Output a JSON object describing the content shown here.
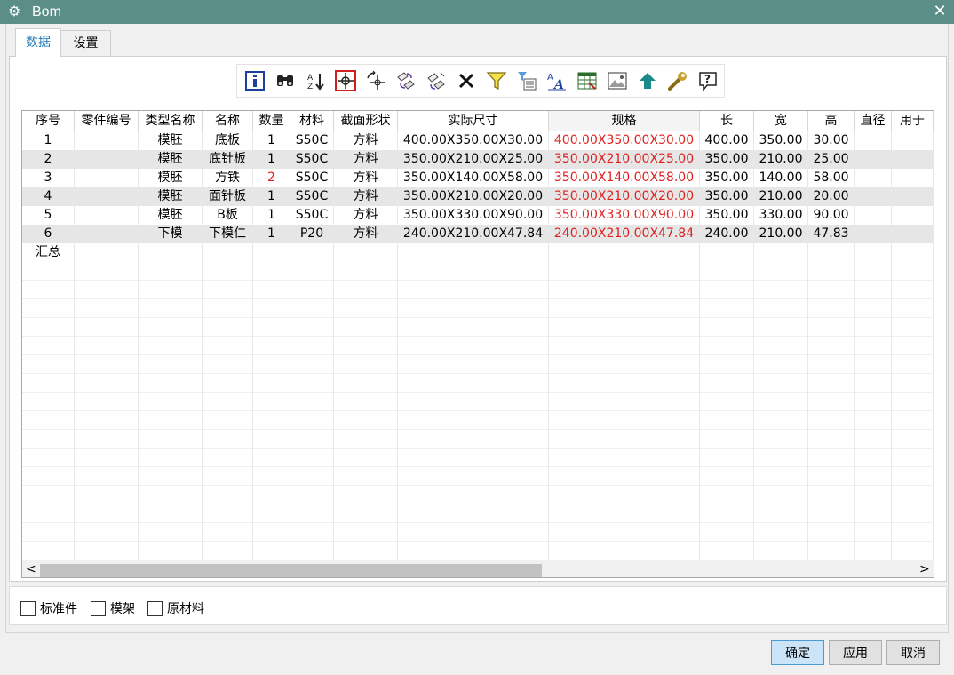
{
  "window": {
    "title": "Bom",
    "icon": "gear-icon",
    "close_icon": "close-icon"
  },
  "tabs": [
    {
      "label": "数据",
      "active": true
    },
    {
      "label": "设置",
      "active": false
    }
  ],
  "toolbar": {
    "icons": [
      "info-icon",
      "binoculars-icon",
      "sort-az-icon",
      "crosshair-icon",
      "rotate-point-icon",
      "swap-part-icon",
      "swap-part-2-icon",
      "delete-icon",
      "filter-icon",
      "column-filter-icon",
      "font-icon",
      "table-export-icon",
      "image-icon",
      "upload-arrow-icon",
      "wrench-icon",
      "help-icon"
    ]
  },
  "table": {
    "headers": [
      "序号",
      "零件编号",
      "类型名称",
      "名称",
      "数量",
      "材料",
      "截面形状",
      "实际尺寸",
      "规格",
      "长",
      "宽",
      "高",
      "直径",
      "用于"
    ],
    "rows": [
      [
        "1",
        "",
        "模胚",
        "底板",
        "1",
        "S50C",
        "方料",
        "400.00X350.00X30.00",
        "400.00X350.00X30.00",
        "400.00",
        "350.00",
        "30.00",
        "",
        ""
      ],
      [
        "2",
        "",
        "模胚",
        "底针板",
        "1",
        "S50C",
        "方料",
        "350.00X210.00X25.00",
        "350.00X210.00X25.00",
        "350.00",
        "210.00",
        "25.00",
        "",
        ""
      ],
      [
        "3",
        "",
        "模胚",
        "方铁",
        "2",
        "S50C",
        "方料",
        "350.00X140.00X58.00",
        "350.00X140.00X58.00",
        "350.00",
        "140.00",
        "58.00",
        "",
        ""
      ],
      [
        "4",
        "",
        "模胚",
        "面针板",
        "1",
        "S50C",
        "方料",
        "350.00X210.00X20.00",
        "350.00X210.00X20.00",
        "350.00",
        "210.00",
        "20.00",
        "",
        ""
      ],
      [
        "5",
        "",
        "模胚",
        "B板",
        "1",
        "S50C",
        "方料",
        "350.00X330.00X90.00",
        "350.00X330.00X90.00",
        "350.00",
        "330.00",
        "90.00",
        "",
        ""
      ],
      [
        "6",
        "",
        "下模",
        "下模仁",
        "1",
        "P20",
        "方料",
        "240.00X210.00X47.84",
        "240.00X210.00X47.84",
        "240.00",
        "210.00",
        "47.83",
        "",
        ""
      ]
    ],
    "summary_label": "汇总"
  },
  "checkboxes": [
    {
      "label": "标准件",
      "checked": false
    },
    {
      "label": "模架",
      "checked": false
    },
    {
      "label": "原材料",
      "checked": false
    }
  ],
  "buttons": {
    "ok": "确定",
    "apply": "应用",
    "cancel": "取消"
  },
  "colors": {
    "titlebar": "#5c8e88",
    "highlight_red": "#e02020",
    "active_tab": "#2b7fb8"
  }
}
